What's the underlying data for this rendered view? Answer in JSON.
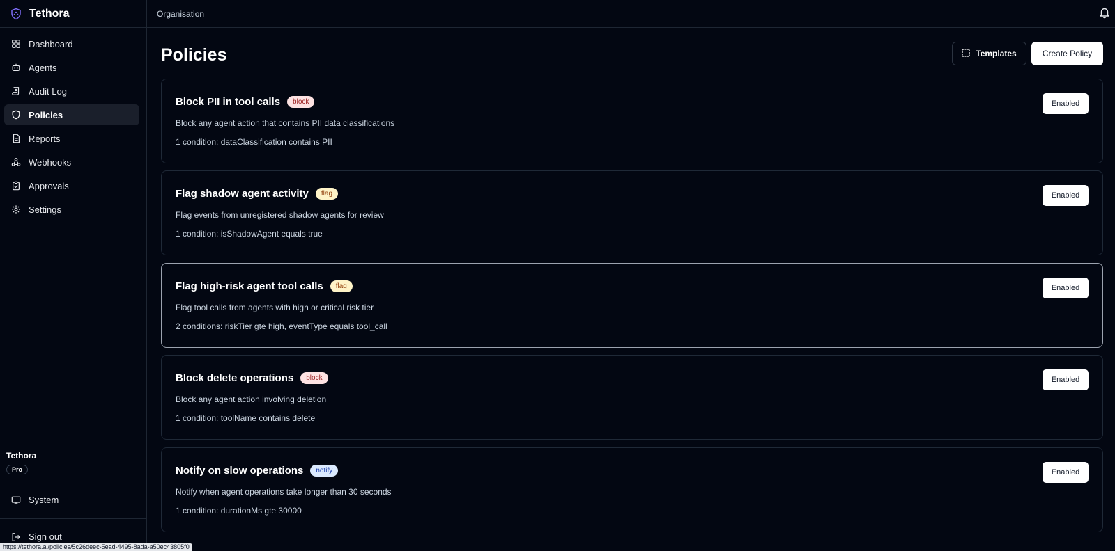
{
  "app": {
    "name": "Tethora",
    "brand_color": "#6d5dfc"
  },
  "topbar": {
    "breadcrumb": "Organisation",
    "bell_icon": "bell-icon"
  },
  "sidebar": {
    "items": [
      {
        "label": "Dashboard",
        "icon": "grid-icon",
        "active": false
      },
      {
        "label": "Agents",
        "icon": "bot-icon",
        "active": false
      },
      {
        "label": "Audit Log",
        "icon": "scroll-icon",
        "active": false
      },
      {
        "label": "Policies",
        "icon": "shield-icon",
        "active": true
      },
      {
        "label": "Reports",
        "icon": "file-icon",
        "active": false
      },
      {
        "label": "Webhooks",
        "icon": "webhook-icon",
        "active": false
      },
      {
        "label": "Approvals",
        "icon": "clipboard-check-icon",
        "active": false
      },
      {
        "label": "Settings",
        "icon": "gear-icon",
        "active": false
      }
    ],
    "org_name": "Tethora",
    "plan": "Pro",
    "system_label": "System",
    "signout_label": "Sign out"
  },
  "page": {
    "title": "Policies",
    "templates_label": "Templates",
    "create_label": "Create Policy"
  },
  "policies": [
    {
      "title": "Block PII in tool calls",
      "action": "block",
      "description": "Block any agent action that contains PII data classifications",
      "conditions": "1 condition: dataClassification contains PII",
      "status": "Enabled"
    },
    {
      "title": "Flag shadow agent activity",
      "action": "flag",
      "description": "Flag events from unregistered shadow agents for review",
      "conditions": "1 condition: isShadowAgent equals true",
      "status": "Enabled"
    },
    {
      "title": "Flag high-risk agent tool calls",
      "action": "flag",
      "description": "Flag tool calls from agents with high or critical risk tier",
      "conditions": "2 conditions: riskTier gte high, eventType equals tool_call",
      "status": "Enabled"
    },
    {
      "title": "Block delete operations",
      "action": "block",
      "description": "Block any agent action involving deletion",
      "conditions": "1 condition: toolName contains delete",
      "status": "Enabled"
    },
    {
      "title": "Notify on slow operations",
      "action": "notify",
      "description": "Notify when agent operations take longer than 30 seconds",
      "conditions": "1 condition: durationMs gte 30000",
      "status": "Enabled"
    }
  ],
  "status_bar": {
    "url": "https://tethora.ai/policies/5c26deec-5ead-4495-8ada-a50ec43805f0"
  }
}
